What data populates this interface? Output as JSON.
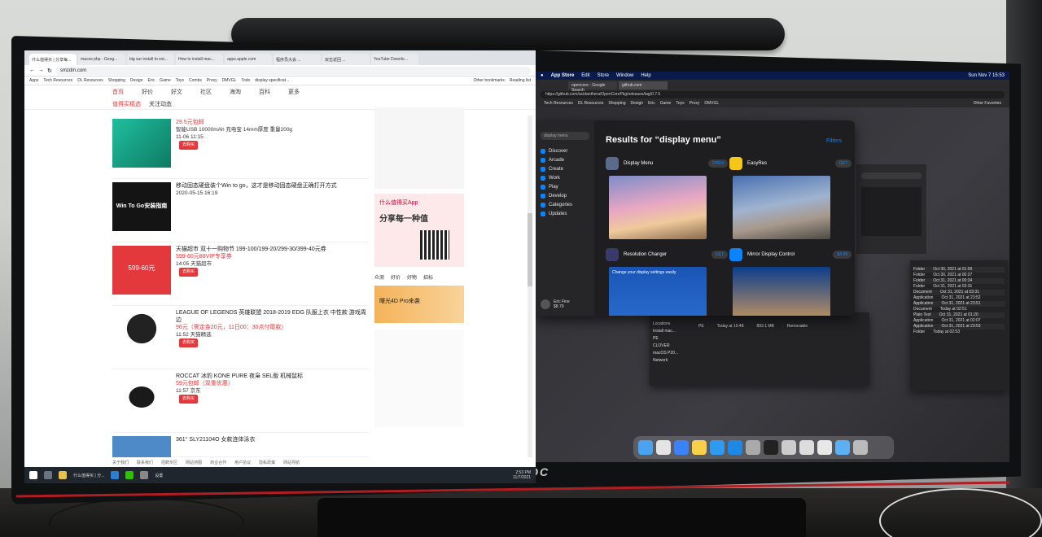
{
  "left_screen": {
    "tabs": [
      "什么值得买 | 分享每...",
      "macos php - Goog...",
      "big sur install to ext...",
      "How to install mac...",
      "apps.apple.com",
      "程序员大会 ...",
      "双击返回 ...",
      "YouTube Downlo..."
    ],
    "url": "smzdm.com",
    "bookmarks": [
      "Apps",
      "Tech Resources",
      "DL Resources",
      "Shopping",
      "Design",
      "Eric",
      "Game",
      "Toys",
      "Combs",
      "Proxy",
      "DMVGL",
      "Todo",
      "display specificat...",
      "Other bookmarks",
      "Reading list"
    ],
    "site_nav": [
      "首页",
      "好价",
      "好文",
      "社区",
      "海淘",
      "百科",
      "更多"
    ],
    "sub_nav": [
      "值得买精选",
      "关注动态"
    ],
    "feed": [
      {
        "title": "29.5元包邮",
        "desc": "智能USB 10000mAh 充电宝 14mm厚度 重量200g",
        "price": "",
        "meta": "11-06 11:15"
      },
      {
        "title": "移动固态硬盘装个Win to go，这才是移动固态硬盘正确打开方式",
        "desc": "Win To Go安装指南",
        "price": "",
        "meta": "2020-05-15 16:19"
      },
      {
        "title": "天猫超市 双十一购物节 199-100/199-20/299-30/399-40元券",
        "desc": "599-60元88VIP专享券",
        "price": "599-60元",
        "meta": "14:05 天猫超市"
      },
      {
        "title": "LEAGUE OF LEGENDS 英雄联盟 2018-2019 EDG 队服上衣 中性款 游戏周边",
        "desc": "96元（需定金20元，11日00：30点付尾款）",
        "price": "96元",
        "meta": "11:52 天猫精选"
      },
      {
        "title": "ROCCAT 冰豹 KONE PURE 夜枭 SEL版 机械鼠标",
        "desc": "59元包邮（双重优惠）",
        "price": "59元包邮",
        "meta": "11:57 京东"
      },
      {
        "title": "361° SLY21104O 女款连体泳衣",
        "desc": "",
        "price": "",
        "meta": ""
      }
    ],
    "buy_label": "去购买",
    "app_promo": {
      "title": "什么值得买App",
      "tagline": "分享每一种值"
    },
    "side_tabs": [
      "众测",
      "好价",
      "好物",
      "招标"
    ],
    "banner": "曙光4D Pro来袭",
    "taskbar": {
      "tab": "什么值得买 | 分...",
      "settings": "设置",
      "time": "2:53 PM",
      "date": "11/7/2021"
    },
    "footer_links": [
      "关于我们",
      "联系我们",
      "招聘专区",
      "网站地图",
      "商业合作",
      "用户协议",
      "隐私政策",
      "网站导航"
    ]
  },
  "right_screen": {
    "menubar": [
      "App Store",
      "Edit",
      "Store",
      "Window",
      "Help"
    ],
    "clock": "Sun Nov 7 15:53",
    "tabs": [
      "opencore - Google Search",
      "github.com"
    ],
    "url": "https://github.com/acidanthera/OpenCorePkg/releases/tag/0.7.5",
    "bookmarks": [
      "Tech Resources",
      "DL Resources",
      "Shopping",
      "Design",
      "Eric",
      "Game",
      "Toys",
      "Proxy",
      "DMVGL",
      "Other Favorites"
    ],
    "appstore": {
      "search": "display menu",
      "nav": [
        "Discover",
        "Arcade",
        "Create",
        "Work",
        "Play",
        "Develop",
        "Categories",
        "Updates"
      ],
      "title": "Results for “display menu”",
      "filters": "Filters",
      "results": [
        {
          "name": "Display Menu",
          "category": "Utilities",
          "action": "OPEN"
        },
        {
          "name": "EasyRes",
          "category": "Utilities",
          "action": "GET"
        },
        {
          "name": "Resolution Changer",
          "category": "High quality pictures",
          "action": "GET"
        },
        {
          "name": "Mirror Display Control",
          "category": "Utilities",
          "action": "$4.99"
        }
      ],
      "screenshot_caption": "Change your display settings easily",
      "user": {
        "name": "Eric Fine",
        "credit": "$8.79"
      }
    },
    "finder_rows": [
      [
        "Folder",
        "Oct 30, 2021 at 01:09"
      ],
      [
        "Folder",
        "Oct 30, 2021 at 00:27"
      ],
      [
        "Folder",
        "Oct 31, 2021 at 00:34"
      ],
      [
        "Folder",
        "Oct 31, 2021 at 03:31"
      ],
      [
        "Document",
        "Oct 31, 2021 at 03:31"
      ],
      [
        "Application",
        "Oct 31, 2021 at 23:52"
      ],
      [
        "Application",
        "Oct 31, 2021 at 23:51"
      ],
      [
        "Document",
        "Today at 02:51"
      ],
      [
        "Plain Text",
        "Oct 31, 2021 at 01:20"
      ],
      [
        "Application",
        "Oct 31, 2021 at 02:07"
      ],
      [
        "Application",
        "Oct 31, 2021 at 23:53"
      ],
      [
        "Folder",
        "Today at 02:53"
      ]
    ],
    "finder_sidebar": [
      "Locations",
      "Install mac...",
      "PE",
      "CLOVER",
      "macOS P20...",
      "Network"
    ],
    "finder2_item": "PE",
    "finder2_date": "Today at 10:48",
    "finder2_size": "893.1 MB",
    "finder2_kind": "Removable"
  },
  "monitor_brand": "AOC"
}
